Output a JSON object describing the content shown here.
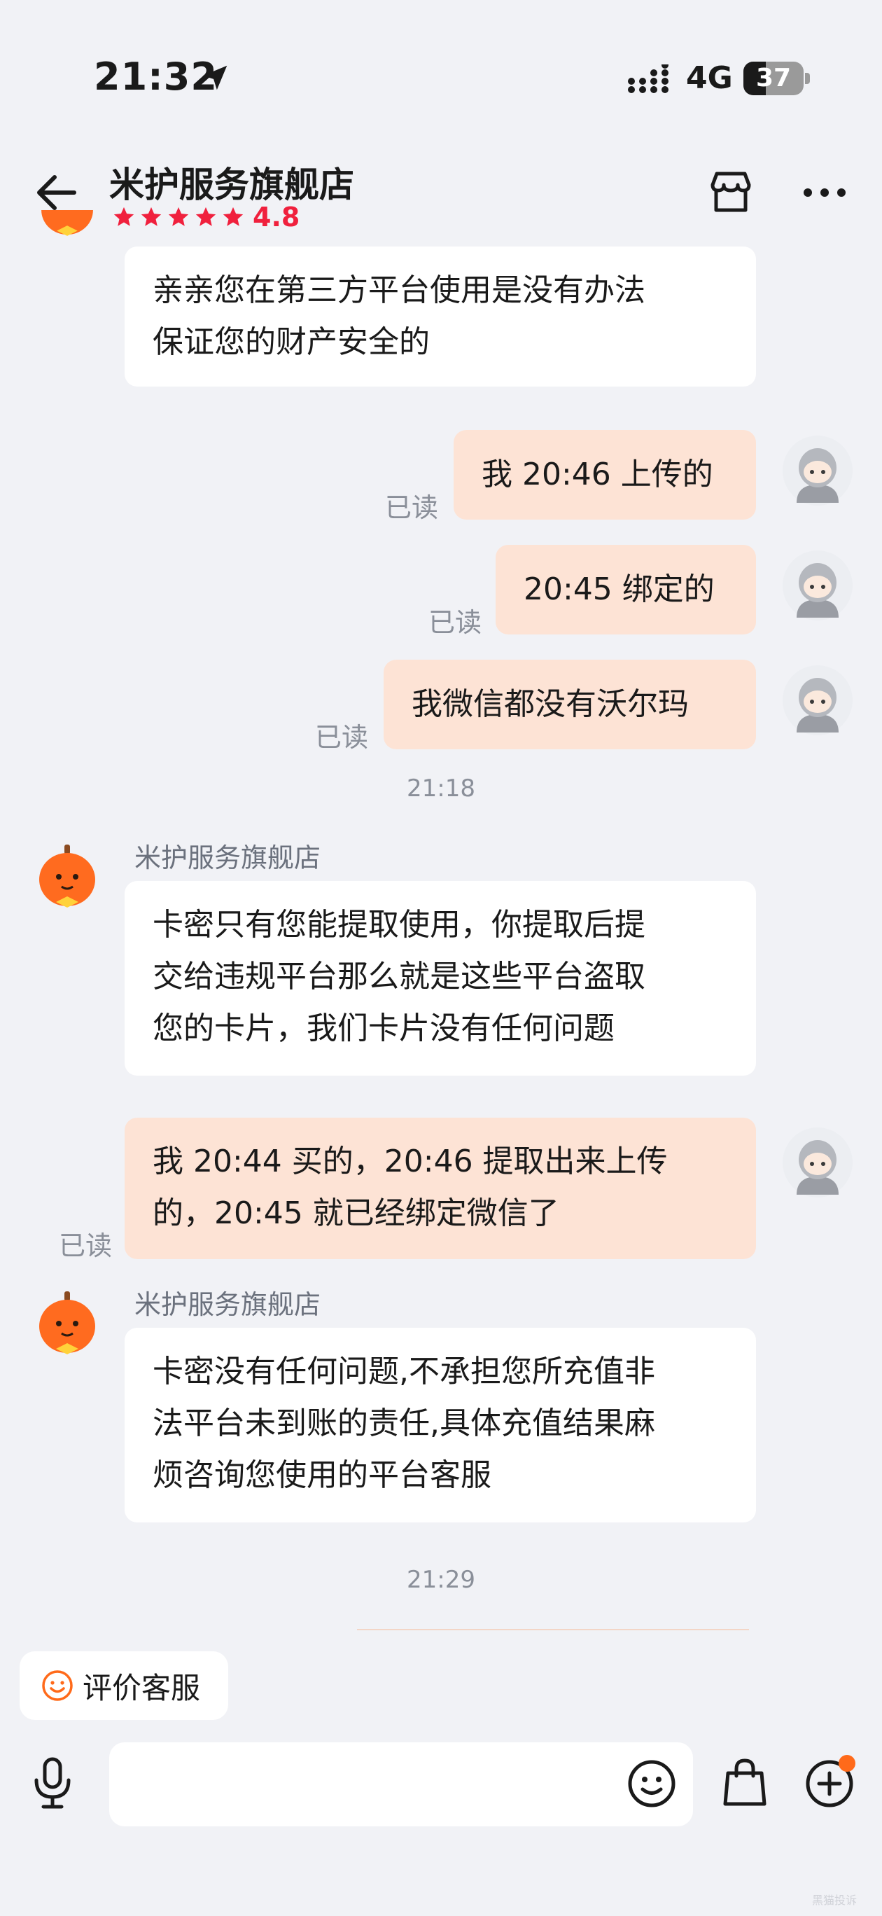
{
  "status_bar": {
    "time": "21:32",
    "network": "4G",
    "battery": "37",
    "battery_level": 0.37
  },
  "header": {
    "title": "米护服务旗舰店",
    "rating": "4.8",
    "stars": 5
  },
  "messages": {
    "m1": {
      "lines": [
        "亲亲您在第三方平台使用是没有办法",
        "保证您的财产安全的"
      ]
    },
    "m2": {
      "text": "我 20:46 上传的",
      "status": "已读"
    },
    "m3": {
      "text": "20:45 绑定的",
      "status": "已读"
    },
    "m4": {
      "text": "我微信都没有沃尔玛",
      "status": "已读"
    },
    "t1": "21:18",
    "m5": {
      "sender": "米护服务旗舰店",
      "lines": [
        "卡密只有您能提取使用，你提取后提",
        "交给违规平台那么就是这些平台盗取",
        "您的卡片，我们卡片没有任何问题"
      ]
    },
    "m6": {
      "lines": [
        "我 20:44 买的，20:46 提取出来上传",
        "的，20:45 就已经绑定微信了"
      ],
      "status": "已读"
    },
    "m7": {
      "sender": "米护服务旗舰店",
      "lines": [
        "卡密没有任何问题,不承担您所充值非",
        "法平台未到账的责任,具体充值结果麻",
        "烦咨询您使用的平台客服"
      ]
    },
    "t2": "21:29"
  },
  "footer": {
    "rate_cs_label": "评价客服",
    "watermark": "黑猫投诉"
  },
  "icons": {
    "location": "location-arrow-icon",
    "signal": "signal-icon",
    "battery": "battery-icon",
    "back": "back-arrow-icon",
    "store": "store-icon",
    "more": "more-icon",
    "smile": "smile-icon",
    "mic": "microphone-icon",
    "emoji": "emoji-icon",
    "bag": "shopping-bag-icon",
    "plus": "plus-circle-icon"
  },
  "colors": {
    "rating": "#f0203d",
    "seller_bubble": "#ffffff",
    "buyer_bubble": "#fde3d5",
    "accent_orange": "#ff6a1a"
  }
}
